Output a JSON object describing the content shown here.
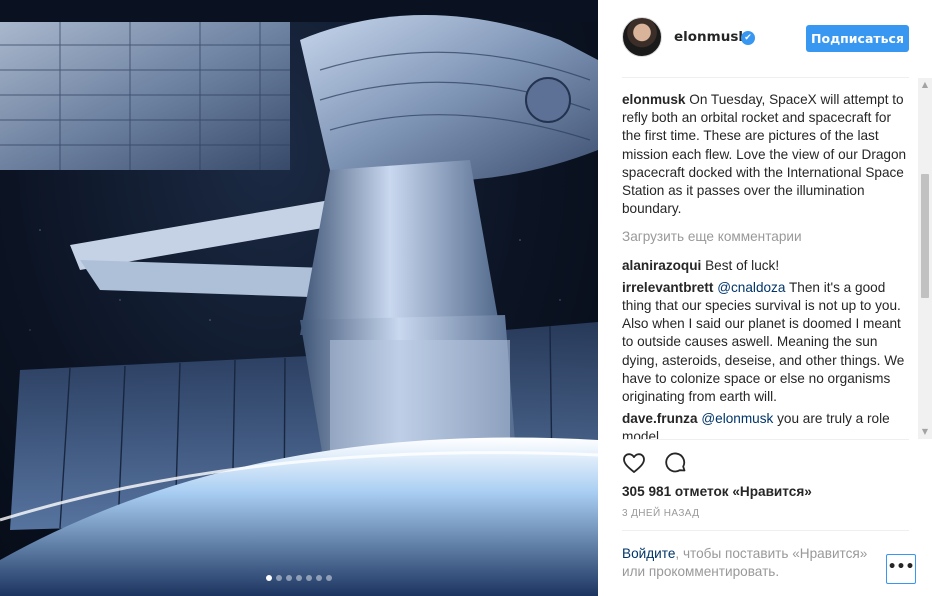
{
  "photo": {
    "alt_subject": "",
    "carousel": {
      "count": 7,
      "active_index": 0
    }
  },
  "header": {
    "username": "elonmusk",
    "verified_icon": "✔",
    "follow_label": "Подписаться"
  },
  "caption": {
    "author": "elonmusk",
    "text": "On Tuesday, SpaceX will attempt to refly both an orbital rocket and spacecraft for the first time. These are pictures of the last mission each flew. Love the view of our Dragon spacecraft docked with the International Space Station as it passes over the illumination boundary."
  },
  "load_more_label": "Загрузить еще комментарии",
  "comments": [
    {
      "author": "alanirazoqui",
      "mention": "",
      "text": "Best of luck!"
    },
    {
      "author": "irrelevantbrett",
      "mention": "@cnaldoza",
      "text": "Then it's a good thing that our species survival is not up to you. Also when I said our planet is doomed I meant to outside causes aswell. Meaning the sun dying, asteroids, deseise, and other things. We have to colonize space or else no organisms originating from earth will."
    },
    {
      "author": "dave.frunza",
      "mention": "@elonmusk",
      "text": "you are truly a role model."
    }
  ],
  "actions": {
    "like_icon": "heart-icon",
    "comment_icon": "comment-icon"
  },
  "likes_text": "305 981 отметок «Нравится»",
  "time_text": "3 дней назад",
  "login_prompt": {
    "link": "Войдите",
    "rest": ", чтобы поставить «Нравится» или прокомментировать."
  },
  "more_label": "•••",
  "colors": {
    "accent": "#3897f0",
    "mention": "#003569",
    "muted": "#999999"
  }
}
